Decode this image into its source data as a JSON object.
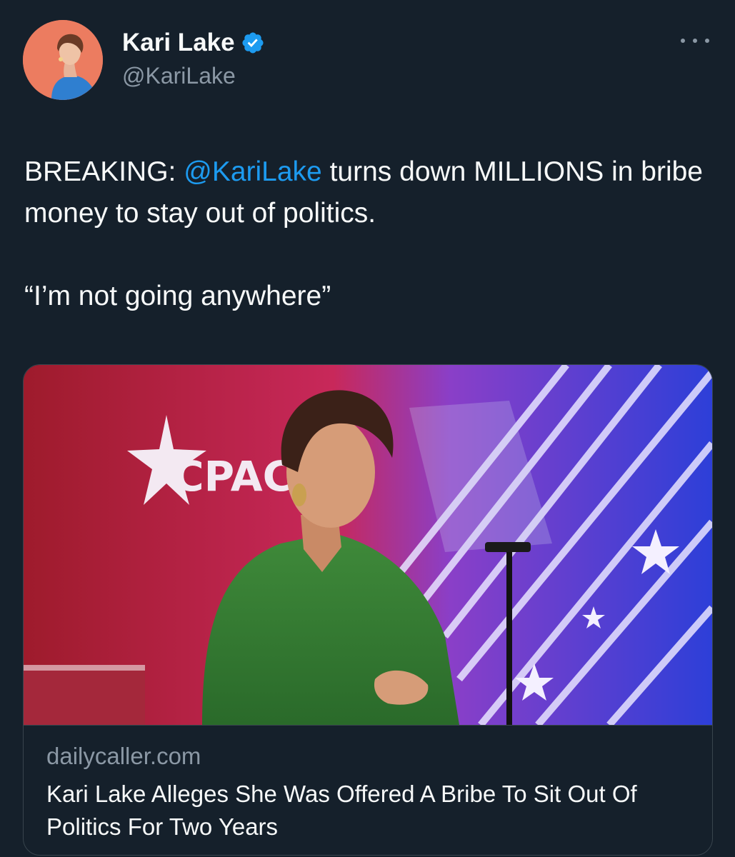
{
  "author": {
    "display_name": "Kari Lake",
    "handle": "@KariLake",
    "verified": true,
    "avatar_icon": "profile-photo"
  },
  "tweet": {
    "text_prefix": "BREAKING: ",
    "mention": "@KariLake",
    "text_suffix": " turns down MILLIONS in bribe money to stay out of politics.",
    "quote_line": "“I’m not going anywhere”"
  },
  "card": {
    "image_text": "CPAC",
    "domain": "dailycaller.com",
    "title": "Kari Lake Alleges She Was Offered A Bribe To Sit Out Of Politics For Two Years"
  },
  "colors": {
    "background": "#15202b",
    "text": "#f7f9f9",
    "secondary": "#8b98a5",
    "link": "#1d9bf0",
    "border": "#38444d"
  }
}
